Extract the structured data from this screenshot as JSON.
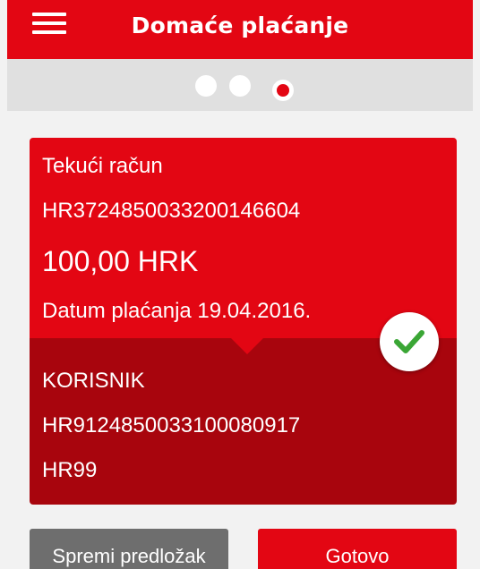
{
  "header": {
    "title": "Domaće plaćanje",
    "menu_icon": "hamburger-menu-icon"
  },
  "stepper": {
    "total_steps": 3,
    "current_step": 3
  },
  "payment": {
    "account_type": "Tekući račun",
    "account_iban": "HR3724850033200146604",
    "amount": "100,00 HRK",
    "payment_date": "Datum plaćanja 19.04.2016.",
    "recipient_name": "KORISNIK",
    "recipient_iban": "HR9124850033100080917",
    "reference_model": "HR99",
    "status_icon": "checkmark-icon"
  },
  "actions": {
    "save_template_label": "Spremi predložak",
    "done_label": "Gotovo"
  },
  "colors": {
    "brand_red": "#e30613",
    "dark_red": "#a8050d",
    "check_green": "#3aa635",
    "secondary_button": "#6e6e6e"
  }
}
